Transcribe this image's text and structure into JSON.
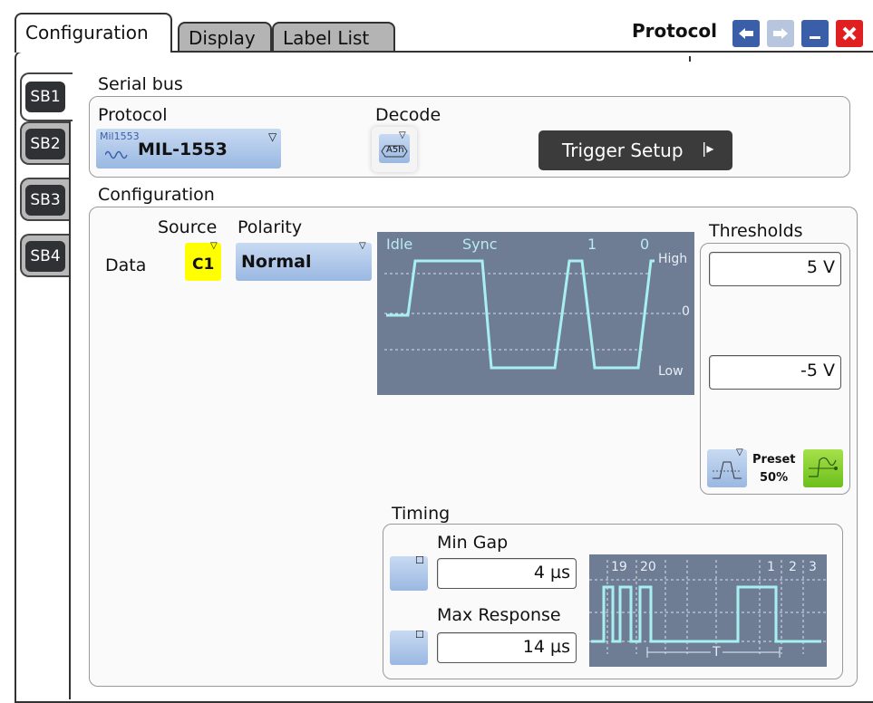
{
  "window": {
    "title": "Protocol",
    "tabs": [
      {
        "label": "Configuration"
      },
      {
        "label": "Display"
      },
      {
        "label": "Label List"
      }
    ]
  },
  "side_tabs": [
    {
      "label": "SB1"
    },
    {
      "label": "SB2"
    },
    {
      "label": "SB3"
    },
    {
      "label": "SB4"
    }
  ],
  "serial_bus": {
    "heading": "Serial bus",
    "protocol_label": "Protocol",
    "protocol_value": "MIL-1553",
    "protocol_icon_text": "Mil1553",
    "decode_label": "Decode",
    "decode_icon_text": "A5h",
    "trigger_setup_label": "Trigger Setup"
  },
  "configuration": {
    "heading": "Configuration",
    "source_header": "Source",
    "polarity_header": "Polarity",
    "data_label": "Data",
    "source_value": "C1",
    "polarity_value": "Normal",
    "diagram_labels": {
      "idle": "Idle",
      "sync": "Sync",
      "one": "1",
      "zero": "0",
      "high": "High",
      "zero_level": "0",
      "low": "Low"
    }
  },
  "thresholds": {
    "heading": "Thresholds",
    "high_value": "5 V",
    "low_value": "-5 V",
    "preset_label": "Preset",
    "preset_value": "50%"
  },
  "timing": {
    "heading": "Timing",
    "min_gap_label": "Min Gap",
    "min_gap_value": "4 µs",
    "max_response_label": "Max Response",
    "max_response_value": "14 µs",
    "diagram_labels": {
      "b19": "19",
      "b20": "20",
      "b1": "1",
      "b2": "2",
      "b3": "3",
      "t": "T"
    }
  },
  "colors": {
    "accent_blue": "#3a5fa8",
    "diagram_bg": "#6e7d94",
    "signal": "#a8f0f0",
    "source_yellow": "#ffff00"
  }
}
